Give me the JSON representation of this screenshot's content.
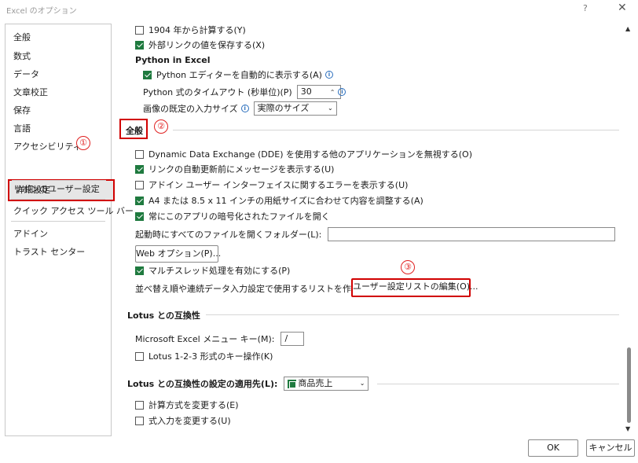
{
  "window": {
    "title": "Excel のオプション",
    "help": "?",
    "close": "✕"
  },
  "sidebar": {
    "items": [
      "全般",
      "数式",
      "データ",
      "文章校正",
      "保存",
      "言語",
      "アクセシビリティ",
      "詳細設定",
      "リボンのユーザー設定",
      "クイック アクセス ツール バー",
      "アドイン",
      "トラスト センター"
    ],
    "selected_index": 7
  },
  "badges": {
    "one": "①",
    "two": "②",
    "three": "③"
  },
  "content": {
    "date1904_label": "1904 年から計算する(Y)",
    "external_link_label": "外部リンクの値を保存する(X)",
    "python_heading": "Python in Excel",
    "python_editor_label": "Python エディターを自動的に表示する(A)",
    "python_timeout_label": "Python 式のタイムアウト (秒単位)(P)",
    "python_timeout_value": "30",
    "image_size_label": "画像の既定の入力サイズ",
    "image_size_value": "実際のサイズ",
    "general_heading": "全般",
    "dde_label": "Dynamic Data Exchange (DDE) を使用する他のアプリケーションを無視する(O)",
    "link_update_label": "リンクの自動更新前にメッセージを表示する(U)",
    "addin_error_label": "アドイン ユーザー インターフェイスに関するエラーを表示する(U)",
    "a4_label": "A4 または 8.5 x 11 インチの用紙サイズに合わせて内容を調整する(A)",
    "encrypted_label": "常にこのアプリの暗号化されたファイルを開く",
    "startup_folder_label": "起動時にすべてのファイルを開くフォルダー(L):",
    "startup_folder_value": "",
    "web_options_button": "Web オプション(P)...",
    "multithread_label": "マルチスレッド処理を有効にする(P)",
    "custom_list_label": "並べ替え順や連続データ入力設定で使用するリストを作成します:",
    "custom_list_button": "ユーザー設定リストの編集(O)...",
    "lotus_heading": "Lotus との互換性",
    "menu_key_label": "Microsoft Excel メニュー キー(M):",
    "menu_key_value": "/",
    "lotus_keys_label": "Lotus 1-2-3 形式のキー操作(K)",
    "lotus_apply_label": "Lotus との互換性の設定の適用先(L):",
    "lotus_apply_value": "商品売上",
    "formula_eval_label": "計算方式を変更する(E)",
    "formula_entry_label": "式入力を変更する(U)"
  },
  "checks": {
    "date1904": false,
    "external_link": true,
    "python_editor": true,
    "dde": false,
    "link_update": true,
    "addin_error": false,
    "a4": true,
    "encrypted": true,
    "multithread": true,
    "lotus_keys": false,
    "formula_eval": false,
    "formula_entry": false
  },
  "footer": {
    "ok": "OK",
    "cancel": "キャンセル"
  },
  "colors": {
    "highlight_red": "#d10000",
    "check_green": "#1f7a3f",
    "info_blue": "#2a6ebd"
  }
}
